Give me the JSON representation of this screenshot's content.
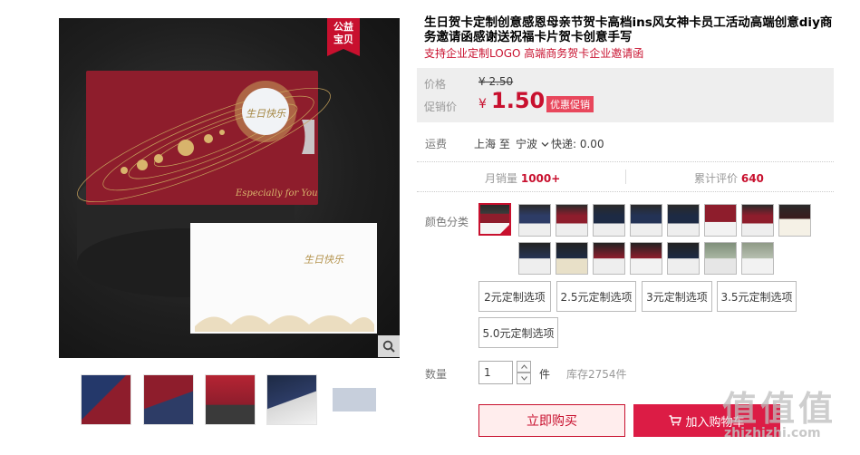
{
  "product": {
    "title": "生日贺卡定制创意感恩母亲节贺卡高档ins风女神卡员工活动高端创意diy商务邀请函感谢送祝福卡片贺卡创意手写",
    "subtitle": "支持企业定制LOGO 高端商务贺卡企业邀请函",
    "badge": [
      "公益",
      "宝贝"
    ],
    "card_script_text": "Especially for You",
    "card_center_text": "生日快乐"
  },
  "price": {
    "label": "价格",
    "original": "¥ 2.50",
    "promo_label": "促销价",
    "currency": "¥",
    "current": "1.50",
    "tag": "优惠促销"
  },
  "shipping": {
    "label": "运费",
    "from_to": "上海 至",
    "destination": "宁波",
    "fee": "快递: 0.00"
  },
  "stats": {
    "monthly_label": "月销量",
    "monthly_value": "1000+",
    "reviews_label": "累计评价",
    "reviews_value": "640"
  },
  "color": {
    "label": "颜色分类",
    "swatch_count": 15,
    "options": [
      "2元定制选项",
      "2.5元定制选项",
      "3元定制选项",
      "3.5元定制选项",
      "5.0元定制选项"
    ]
  },
  "quantity": {
    "label": "数量",
    "value": "1",
    "unit": "件",
    "stock": "库存2754件"
  },
  "actions": {
    "buy_now": "立即购买",
    "add_to_cart": "加入购物车"
  },
  "watermark": {
    "big": "值值值",
    "small": "zhizhizhi.com"
  },
  "colors": {
    "accent": "#c8102e",
    "cart": "#dc1c45",
    "card_red": "#8e1d2c",
    "card_navy": "#1d2a44"
  }
}
